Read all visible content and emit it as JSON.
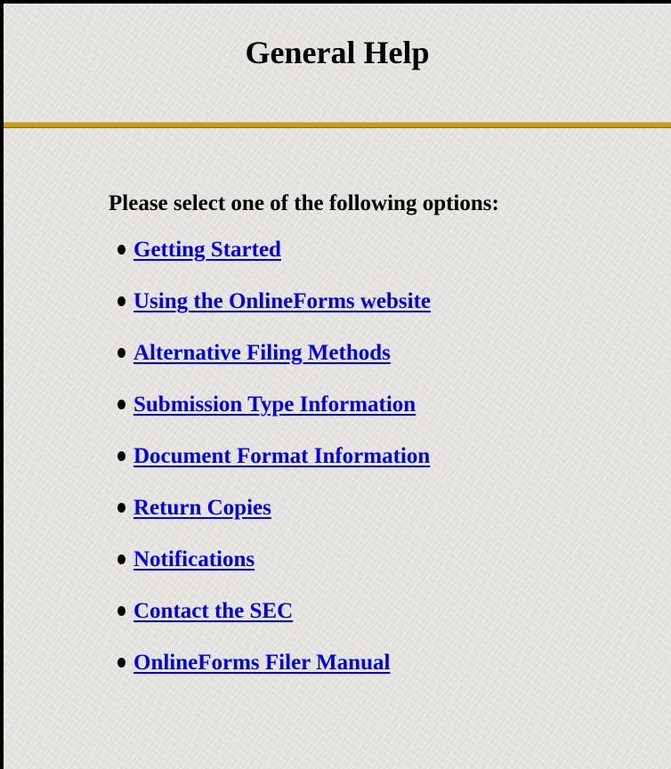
{
  "page": {
    "title": "General Help",
    "prompt": "Please select one of the following options:",
    "link_color": "#0000ee",
    "divider_color": "#c89a1e"
  },
  "options": [
    {
      "label": "Getting Started"
    },
    {
      "label": "Using the OnlineForms website"
    },
    {
      "label": "Alternative Filing Methods"
    },
    {
      "label": "Submission Type Information"
    },
    {
      "label": "Document Format Information"
    },
    {
      "label": "Return Copies"
    },
    {
      "label": "Notifications"
    },
    {
      "label": "Contact the SEC"
    },
    {
      "label": "OnlineForms Filer Manual"
    }
  ]
}
